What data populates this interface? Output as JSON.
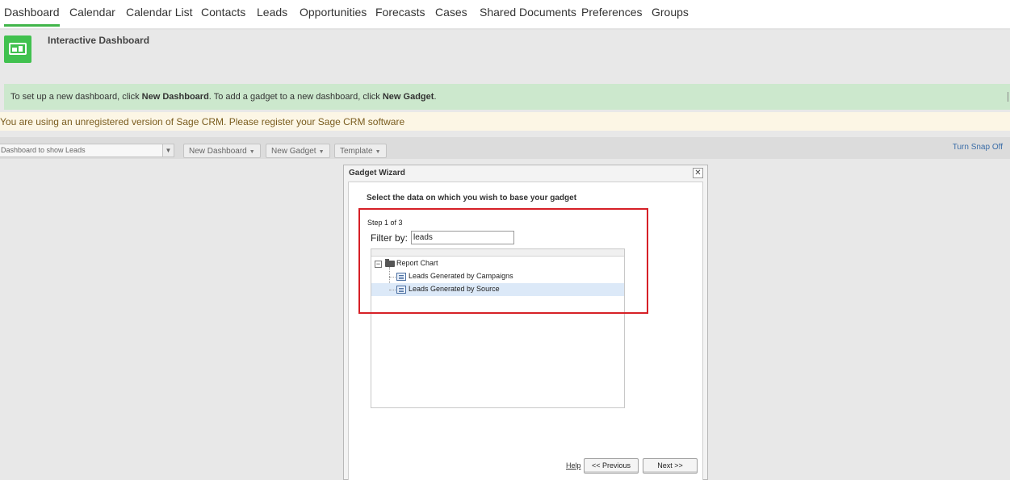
{
  "nav": {
    "tabs": [
      {
        "label": "Dashboard",
        "active": true
      },
      {
        "label": "Calendar"
      },
      {
        "label": "Calendar List"
      },
      {
        "label": "Contacts"
      },
      {
        "label": "Leads"
      },
      {
        "label": "Opportunities"
      },
      {
        "label": "Forecasts"
      },
      {
        "label": "Cases"
      },
      {
        "label": "Shared Documents"
      },
      {
        "label": "Preferences"
      },
      {
        "label": "Groups"
      }
    ]
  },
  "header": {
    "title": "Interactive Dashboard",
    "icon": "dashboard-icon"
  },
  "infobar": {
    "text_1": "To set up a new dashboard, click ",
    "bold_1": "New Dashboard",
    "text_2": ". To add a gadget to a new dashboard, click ",
    "bold_2": "New Gadget",
    "text_3": "."
  },
  "warning": {
    "text": "You are using an unregistered version of Sage CRM. Please register your Sage CRM software"
  },
  "toolbar": {
    "dashboard_select": "Dashboard to show Leads",
    "new_dashboard": "New Dashboard",
    "new_gadget": "New Gadget",
    "template": "Template",
    "turn_snap_off": "Turn Snap Off"
  },
  "wizard": {
    "title": "Gadget Wizard",
    "instruction": "Select the data on which you wish to base your gadget",
    "step": "Step 1 of 3",
    "filter_label": "Filter by:",
    "filter_value": "leads",
    "tree": {
      "folder": "Report Chart",
      "items": [
        {
          "label": "Leads Generated by Campaigns",
          "selected": false
        },
        {
          "label": "Leads Generated by Source",
          "selected": true
        }
      ]
    },
    "help": "Help",
    "previous": "<< Previous",
    "next": "Next >>"
  },
  "colors": {
    "accent": "#41b54a",
    "info_bg": "#cce8cd",
    "warning_bg": "#fcf6e5",
    "highlight": "#d62027",
    "selected_row": "#dce9f8"
  }
}
